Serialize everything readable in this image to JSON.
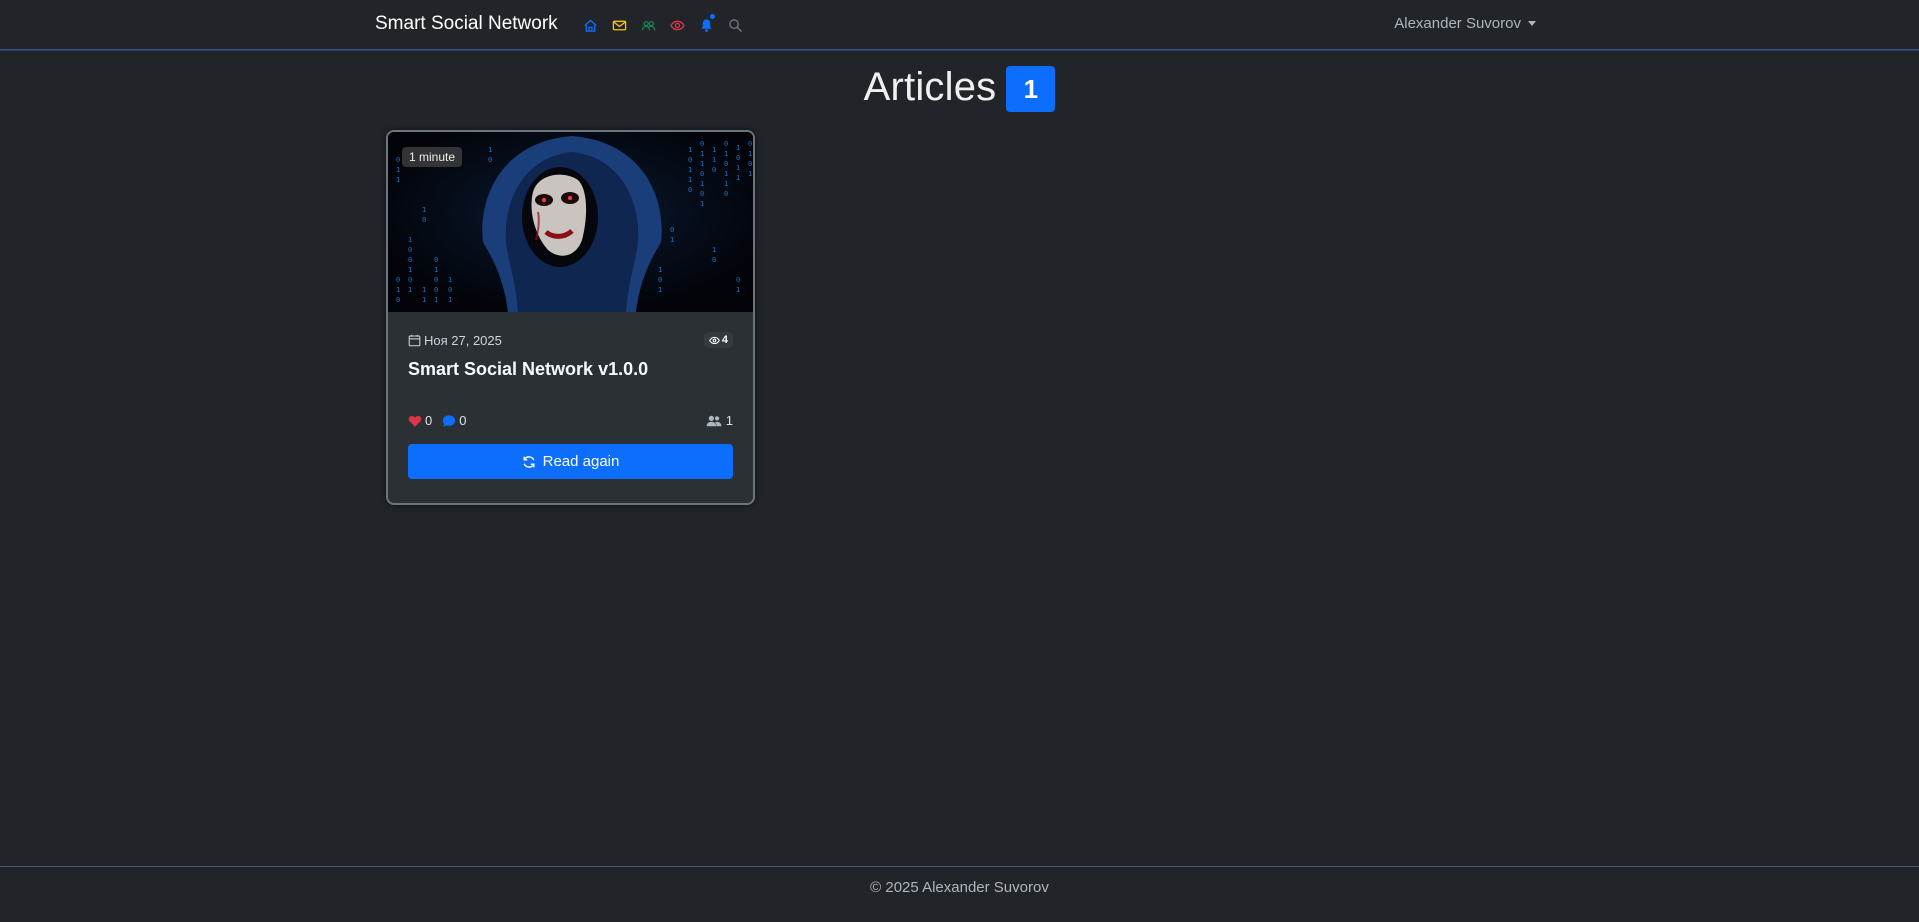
{
  "navbar": {
    "brand": "Smart Social Network",
    "icons": [
      {
        "name": "home-icon",
        "color": "#0d6efd"
      },
      {
        "name": "envelope-icon",
        "color": "#ffc107"
      },
      {
        "name": "people-icon",
        "color": "#198754"
      },
      {
        "name": "eye-icon",
        "color": "#dc3545"
      },
      {
        "name": "bell-icon",
        "color": "#0d6efd"
      },
      {
        "name": "search-icon",
        "color": "#6c757d"
      }
    ],
    "user_name": "Alexander Suvorov"
  },
  "page": {
    "title": "Articles",
    "count": "1"
  },
  "articles": [
    {
      "read_time": "1 minute",
      "date": "Ноя 27, 2025",
      "views": "4",
      "title": "Smart Social Network v1.0.0",
      "likes": "0",
      "comments": "0",
      "readers": "1",
      "button_label": "Read again"
    }
  ],
  "footer": {
    "copyright": "© 2025 Alexander Suvorov"
  },
  "colors": {
    "background": "#212529",
    "accent": "#0d6efd",
    "like": "#dc3545"
  }
}
